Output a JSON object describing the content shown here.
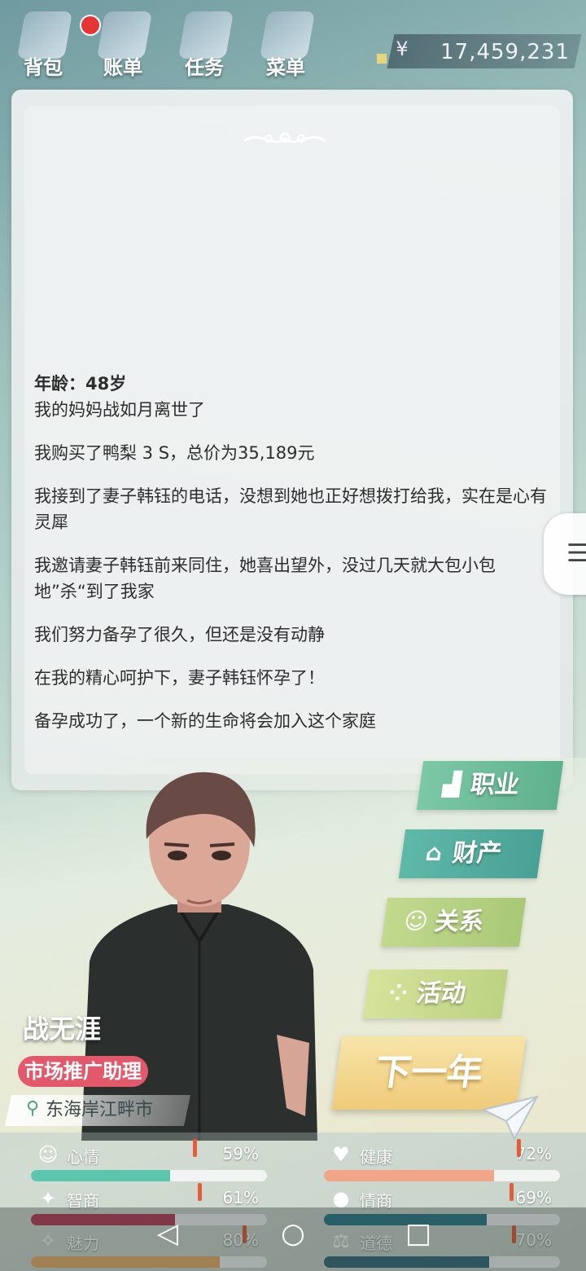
{
  "topbar": {
    "buttons": [
      {
        "label": "背包",
        "icon": "backpack-icon",
        "badge": true
      },
      {
        "label": "账单",
        "icon": "bill-icon"
      },
      {
        "label": "任务",
        "icon": "task-icon"
      },
      {
        "label": "菜单",
        "icon": "menu-icon"
      }
    ],
    "currency_symbol": "¥",
    "money": "17,459,231"
  },
  "log": {
    "age": "年龄：48岁",
    "entries": [
      "我的妈妈战如月离世了",
      "我购买了鸭梨 3 S，总价为35,189元",
      "我接到了妻子韩钰的电话，没想到她也正好想拨打给我，实在是心有灵犀",
      "我邀请妻子韩钰前来同住，她喜出望外，没过几天就大包小包地”杀“到了我家",
      "我们努力备孕了很久，但还是没有动静",
      "在我的精心呵护下，妻子韩钰怀孕了！",
      "备孕成功了，一个新的生命将会加入这个家庭"
    ]
  },
  "actions": {
    "career": "职业",
    "property": "财产",
    "relationship": "关系",
    "activity": "活动",
    "next_year": "下一年"
  },
  "character": {
    "name": "战无涯",
    "job": "市场推广助理",
    "location": "东海岸江畔市"
  },
  "stats": [
    {
      "label": "心情",
      "value": "59%",
      "fill": 0.59,
      "color": "#5cc5ad",
      "icon": "smile-icon"
    },
    {
      "label": "健康",
      "value": "72%",
      "fill": 0.72,
      "color": "#f3a58a",
      "icon": "heart-icon"
    },
    {
      "label": "智商",
      "value": "61%",
      "fill": 0.61,
      "color": "#b8405a",
      "icon": "bulb-icon"
    },
    {
      "label": "情商",
      "value": "69%",
      "fill": 0.69,
      "color": "#2f7c8a",
      "icon": "apple-icon"
    },
    {
      "label": "魅力",
      "value": "80%",
      "fill": 0.8,
      "color": "#e8b06a",
      "icon": "sparkle-icon"
    },
    {
      "label": "道德",
      "value": "70%",
      "fill": 0.7,
      "color": "#3a6f7c",
      "icon": "scale-icon"
    }
  ]
}
